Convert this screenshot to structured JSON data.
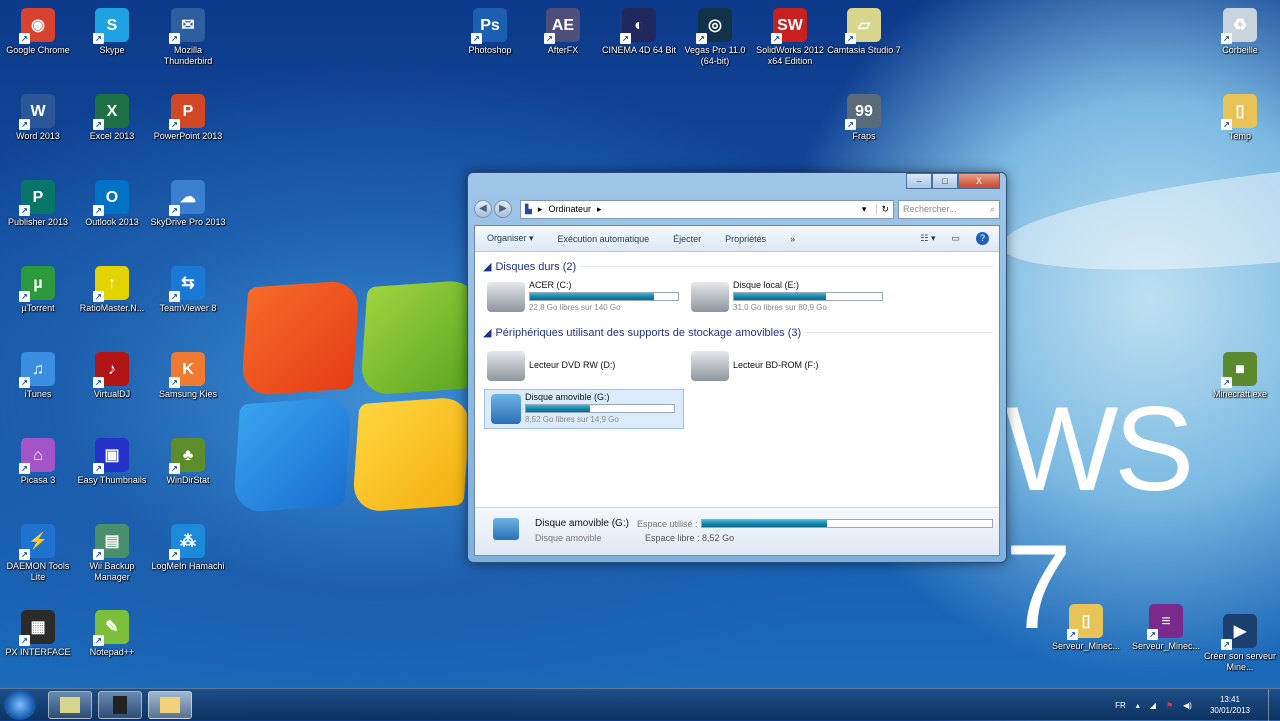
{
  "desktop": {
    "left_icons": [
      {
        "label": "Google Chrome",
        "icon": "chrome-icon",
        "color": "#d8432f",
        "glyph": "◉"
      },
      {
        "label": "Skype",
        "icon": "skype-icon",
        "color": "#1ea2e3",
        "glyph": "S"
      },
      {
        "label": "Mozilla Thunderbird",
        "icon": "thunderbird-icon",
        "color": "#2d5f9e",
        "glyph": "✉"
      },
      {
        "label": "Word 2013",
        "icon": "word-icon",
        "color": "#2b5797",
        "glyph": "W"
      },
      {
        "label": "Excel 2013",
        "icon": "excel-icon",
        "color": "#1e7145",
        "glyph": "X"
      },
      {
        "label": "PowerPoint 2013",
        "icon": "powerpoint-icon",
        "color": "#d24726",
        "glyph": "P"
      },
      {
        "label": "Publisher 2013",
        "icon": "publisher-icon",
        "color": "#077568",
        "glyph": "P"
      },
      {
        "label": "Outlook 2013",
        "icon": "outlook-icon",
        "color": "#0072c6",
        "glyph": "O"
      },
      {
        "label": "SkyDrive Pro 2013",
        "icon": "skydrive-icon",
        "color": "#3b7fd0",
        "glyph": "☁"
      },
      {
        "label": "µTorrent",
        "icon": "utorrent-icon",
        "color": "#2c9a3c",
        "glyph": "µ"
      },
      {
        "label": "RatioMaster.N...",
        "icon": "ratiomaster-icon",
        "color": "#e3d300",
        "glyph": "↑"
      },
      {
        "label": "TeamViewer 8",
        "icon": "teamviewer-icon",
        "color": "#1a79d6",
        "glyph": "⇆"
      },
      {
        "label": "iTunes",
        "icon": "itunes-icon",
        "color": "#3a8fe0",
        "glyph": "♫"
      },
      {
        "label": "VirtualDJ",
        "icon": "virtualdj-icon",
        "color": "#b01414",
        "glyph": "♪"
      },
      {
        "label": "Samsung Kies",
        "icon": "samsung-kies-icon",
        "color": "#f07a30",
        "glyph": "K"
      },
      {
        "label": "Picasa 3",
        "icon": "picasa-icon",
        "color": "#a454c6",
        "glyph": "⌂"
      },
      {
        "label": "Easy Thumbnails",
        "icon": "easy-thumbnails-icon",
        "color": "#2433c8",
        "glyph": "▣"
      },
      {
        "label": "WinDirStat",
        "icon": "windirstat-icon",
        "color": "#5d8c2a",
        "glyph": "♣"
      },
      {
        "label": "DAEMON Tools Lite",
        "icon": "daemon-tools-icon",
        "color": "#1f74d1",
        "glyph": "⚡"
      },
      {
        "label": "Wii Backup Manager",
        "icon": "wii-backup-icon",
        "color": "#4a8f6d",
        "glyph": "▤"
      },
      {
        "label": "LogMeIn Hamachi",
        "icon": "hamachi-icon",
        "color": "#1c8ad8",
        "glyph": "⁂"
      },
      {
        "label": "PX INTERFACE",
        "icon": "px-interface-icon",
        "color": "#2b2b2b",
        "glyph": "▦"
      },
      {
        "label": "Notepad++",
        "icon": "notepadpp-icon",
        "color": "#7cbf3a",
        "glyph": "✎"
      }
    ],
    "top_icons": [
      {
        "label": "Photoshop",
        "icon": "photoshop-icon",
        "color": "#1c5fb0",
        "glyph": "Ps"
      },
      {
        "label": "AfterFX",
        "icon": "aftereffects-icon",
        "color": "#4d4f7a",
        "glyph": "AE"
      },
      {
        "label": "CINEMA 4D 64 Bit",
        "icon": "cinema4d-icon",
        "color": "#20285e",
        "glyph": "◐"
      },
      {
        "label": "Vegas Pro 11.0 (64-bit)",
        "icon": "vegas-pro-icon",
        "color": "#10334a",
        "glyph": "◎"
      },
      {
        "label": "SolidWorks 2012 x64 Edition",
        "icon": "solidworks-icon",
        "color": "#c8201f",
        "glyph": "SW"
      },
      {
        "label": "Camtasia Studio 7",
        "icon": "camtasia-icon",
        "color": "#d7d58e",
        "glyph": "▱"
      },
      {
        "label": "Fraps",
        "icon": "fraps-icon",
        "color": "#5a6a78",
        "glyph": "99"
      }
    ],
    "right_icons": [
      {
        "label": "Corbeille",
        "icon": "recycle-bin-icon",
        "color": "#c9d4de",
        "glyph": "♻"
      },
      {
        "label": "Temp",
        "icon": "folder-icon",
        "color": "#e8c458",
        "glyph": "▯"
      },
      {
        "label": "Minecraft.exe",
        "icon": "minecraft-icon",
        "color": "#5b8a2e",
        "glyph": "■"
      },
      {
        "label": "Serveur_Minec...",
        "icon": "folder-icon",
        "color": "#e8c458",
        "glyph": "▯"
      },
      {
        "label": "Serveur_Minec...",
        "icon": "winrar-icon",
        "color": "#7a2a8a",
        "glyph": "≡"
      },
      {
        "label": "Créer son serveur Mine...",
        "icon": "video-file-icon",
        "color": "#1b3f6e",
        "glyph": "▶"
      }
    ],
    "wallpaper_text": "WS 7"
  },
  "explorer": {
    "controls": {
      "minimize": "–",
      "maximize": "□",
      "close": "X"
    },
    "back": "◀",
    "forward": "▶",
    "breadcrumb": "Ordinateur",
    "search_placeholder": "Rechercher...",
    "toolbar": {
      "organize": "Organiser ▾",
      "autoplay": "Exécution automatique",
      "eject": "Éjecter",
      "properties": "Propriétés",
      "more": "»"
    },
    "groups": [
      {
        "title": "Disques durs (2)",
        "drives": [
          {
            "name": "ACER (C:)",
            "sub": "22,8 Go libres sur 140 Go",
            "used_pct": 84,
            "icon": "windows-drive-icon"
          },
          {
            "name": "Disque local (E:)",
            "sub": "31,0 Go libres sur 80,9 Go",
            "used_pct": 62,
            "icon": "hard-drive-icon"
          }
        ]
      },
      {
        "title": "Périphériques utilisant des supports de stockage amovibles (3)",
        "drives": [
          {
            "name": "Lecteur DVD RW (D:)",
            "icon": "dvd-drive-icon"
          },
          {
            "name": "Lecteur BD-ROM (F:)",
            "icon": "bd-drive-icon"
          },
          {
            "name": "Disque amovible (G:)",
            "sub": "8,52 Go libres sur 14,9 Go",
            "used_pct": 43,
            "icon": "removable-disk-icon"
          }
        ]
      }
    ],
    "details": {
      "name": "Disque amovible (G:)",
      "type": "Disque amovible",
      "used_label": "Espace utilisé :",
      "free_label": "Espace libre :",
      "free_value": "8,52 Go",
      "used_pct": 43
    }
  },
  "taskbar": {
    "lang": "FR",
    "time": "13:41",
    "date": "30/01/2013"
  }
}
